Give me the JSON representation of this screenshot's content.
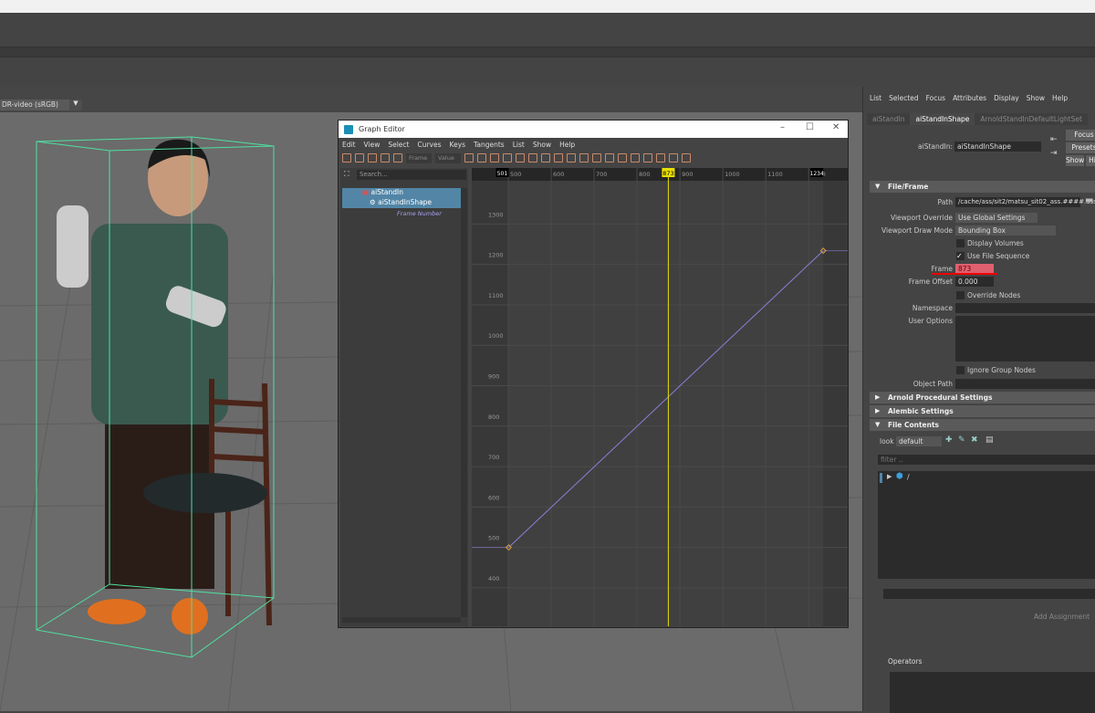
{
  "viewport": {
    "color_space": "DR-video (sRGB)"
  },
  "graph_editor": {
    "title": "Graph Editor",
    "menu": [
      "Edit",
      "View",
      "Select",
      "Curves",
      "Keys",
      "Tangents",
      "List",
      "Show",
      "Help"
    ],
    "frame_field_placeholder": "Frame",
    "value_field_placeholder": "Value",
    "search_placeholder": "Search...",
    "outliner": [
      {
        "label": "aiStandIn",
        "selected": true
      },
      {
        "label": "aiStandInShape",
        "selected": true
      },
      {
        "label": "Frame Number",
        "selected": false
      }
    ],
    "range_start_marker": "501",
    "range_end_marker": "1234",
    "current_time": "873",
    "colors": {
      "curve": "#8a7fd8",
      "time_cursor": "#e8e000",
      "key": "#e0a040"
    }
  },
  "chart_data": {
    "type": "line",
    "x_ticks": [
      500,
      600,
      700,
      800,
      900,
      1000,
      1100,
      1200
    ],
    "y_ticks": [
      400,
      500,
      600,
      700,
      800,
      900,
      1000,
      1100,
      1200,
      1300
    ],
    "xlim": [
      415,
      1291
    ],
    "ylim": [
      305,
      1407
    ],
    "series": [
      {
        "x": [
          501,
          1234
        ],
        "y": [
          500,
          1234
        ]
      }
    ],
    "current_time": 873,
    "grid": true
  },
  "attribute_editor": {
    "menu": [
      "List",
      "Selected",
      "Focus",
      "Attributes",
      "Display",
      "Show",
      "Help"
    ],
    "tabs": [
      {
        "label": "aiStandIn",
        "active": false
      },
      {
        "label": "aiStandInShape",
        "active": true
      },
      {
        "label": "ArnoldStandInDefaultLightSet",
        "active": false
      }
    ],
    "node_label": "aiStandIn:",
    "node_value": "aiStandInShape",
    "buttons": {
      "focus": "Focus",
      "presets": "Presets",
      "show": "Show",
      "hide": "Hi"
    },
    "file_frame": {
      "title": "File/Frame",
      "path_label": "Path",
      "path_value": "/cache/ass/sit2/matsu_sit02_ass.####.ass",
      "viewport_override_label": "Viewport Override",
      "viewport_override_value": "Use Global Settings",
      "viewport_draw_mode_label": "Viewport Draw Mode",
      "viewport_draw_mode_value": "Bounding Box",
      "display_volumes": "Display Volumes",
      "display_volumes_checked": false,
      "use_file_sequence": "Use File Sequence",
      "use_file_sequence_checked": true,
      "frame_label": "Frame",
      "frame_value": "873",
      "frame_offset_label": "Frame Offset",
      "frame_offset_value": "0.000",
      "override_nodes": "Override Nodes",
      "override_nodes_checked": false,
      "namespace_label": "Namespace",
      "user_options_label": "User Options",
      "ignore_group_nodes": "Ignore Group Nodes",
      "ignore_group_nodes_checked": false,
      "object_path_label": "Object Path"
    },
    "sections": [
      "Arnold Procedural Settings",
      "Alembic Settings"
    ],
    "file_contents": {
      "title": "File Contents",
      "look_label": "look",
      "look_value": "default",
      "filter_placeholder": "filter ..",
      "tree_root": "/",
      "add_assignment": "Add Assignment",
      "operators_label": "Operators"
    },
    "highlight_color": "#e06070"
  }
}
